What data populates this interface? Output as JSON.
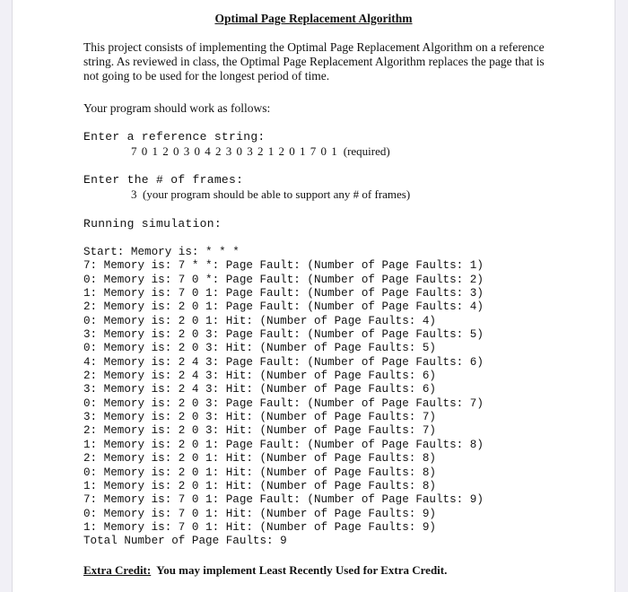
{
  "document": {
    "title": "Optimal Page Replacement Algorithm",
    "intro": "This project consists of implementing the Optimal Page Replacement Algorithm on a reference string.  As reviewed in class, the Optimal Page Replacement Algorithm replaces the page that is not going to be used for the longest period of time.",
    "follows": "Your program should work as follows:",
    "reference_prompt": "Enter a reference string:",
    "reference_string": "7 0 1 2 0 3 0 4 2 3 0 3 2 1 2 0 1 7 0 1",
    "reference_note": "(required)",
    "frames_prompt": "Enter the # of frames:",
    "frames_value": "3",
    "frames_note": "(your program should be able to support any # of frames)",
    "running_label": "Running simulation:",
    "log_lines": [
      "Start: Memory is: * * *",
      "7: Memory is: 7 * *: Page Fault: (Number of Page Faults: 1)",
      "0: Memory is: 7 0 *: Page Fault: (Number of Page Faults: 2)",
      "1: Memory is: 7 0 1: Page Fault: (Number of Page Faults: 3)",
      "2: Memory is: 2 0 1: Page Fault: (Number of Page Faults: 4)",
      "0: Memory is: 2 0 1: Hit: (Number of Page Faults: 4)",
      "3: Memory is: 2 0 3: Page Fault: (Number of Page Faults: 5)",
      "0: Memory is: 2 0 3: Hit: (Number of Page Faults: 5)",
      "4: Memory is: 2 4 3: Page Fault: (Number of Page Faults: 6)",
      "2: Memory is: 2 4 3: Hit: (Number of Page Faults: 6)",
      "3: Memory is: 2 4 3: Hit: (Number of Page Faults: 6)",
      "0: Memory is: 2 0 3: Page Fault: (Number of Page Faults: 7)",
      "3: Memory is: 2 0 3: Hit: (Number of Page Faults: 7)",
      "2: Memory is: 2 0 3: Hit: (Number of Page Faults: 7)",
      "1: Memory is: 2 0 1: Page Fault: (Number of Page Faults: 8)",
      "2: Memory is: 2 0 1: Hit: (Number of Page Faults: 8)",
      "0: Memory is: 2 0 1: Hit: (Number of Page Faults: 8)",
      "1: Memory is: 2 0 1: Hit: (Number of Page Faults: 8)",
      "7: Memory is: 7 0 1: Page Fault: (Number of Page Faults: 9)",
      "0: Memory is: 7 0 1: Hit: (Number of Page Faults: 9)",
      "1: Memory is: 7 0 1: Hit: (Number of Page Faults: 9)",
      "Total Number of Page Faults: 9"
    ],
    "extra_credit_label": "Extra Credit:",
    "extra_credit_text": "You may implement Least Recently Used for Extra Credit."
  }
}
